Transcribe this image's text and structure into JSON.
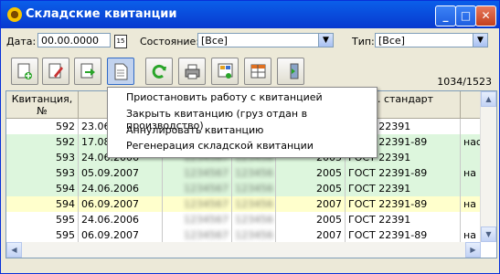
{
  "window": {
    "title": "Складские квитанции"
  },
  "filters": {
    "date_label": "Дата:",
    "date_value": "00.00.0000",
    "state_label": "Состояние:",
    "state_value": "[Все]",
    "type_label": "Тип:",
    "type_value": "[Все]"
  },
  "toolbar": {
    "counter": "1034/1523"
  },
  "context_menu": [
    "Приостановить работу с квитанцией",
    "Закрыть квитанцию (груз отдан в производство)",
    "Аннулировать квитанцию",
    "Регенерация складской квитанции"
  ],
  "table": {
    "headers": [
      "Квитанция, №",
      "Да",
      "",
      "",
      "",
      "с. стандарт",
      ""
    ],
    "rows": [
      {
        "n": "592",
        "date": "23.06.",
        "c3": "",
        "c4": "",
        "year": "",
        "std": "ГОСТ 22391",
        "extra": "",
        "bg": "#ffffff"
      },
      {
        "n": "592",
        "date": "17.08.",
        "c3": "",
        "c4": "",
        "year": "",
        "std": "ГОСТ 22391-89",
        "extra": "нас",
        "bg": "#ddf6dd"
      },
      {
        "n": "593",
        "date": "24.06.2006",
        "c3": "1234567",
        "c4": "123456",
        "year": "2005",
        "std": "ГОСТ 22391",
        "extra": "",
        "bg": "#ddf6dd"
      },
      {
        "n": "593",
        "date": "05.09.2007",
        "c3": "1234567",
        "c4": "123456",
        "year": "2005",
        "std": "ГОСТ 22391-89",
        "extra": "на г",
        "bg": "#ddf6dd"
      },
      {
        "n": "594",
        "date": "24.06.2006",
        "c3": "1234567",
        "c4": "123456",
        "year": "2005",
        "std": "ГОСТ 22391",
        "extra": "",
        "bg": "#ddf6dd"
      },
      {
        "n": "594",
        "date": "06.09.2007",
        "c3": "1234567",
        "c4": "123456",
        "year": "2007",
        "std": "ГОСТ 22391-89",
        "extra": "на г",
        "bg": "#ffffcc"
      },
      {
        "n": "595",
        "date": "24.06.2006",
        "c3": "1234567",
        "c4": "123456",
        "year": "2005",
        "std": "ГОСТ 22391",
        "extra": "",
        "bg": "#ffffff"
      },
      {
        "n": "595",
        "date": "06.09.2007",
        "c3": "1234567",
        "c4": "123456",
        "year": "2007",
        "std": "ГОСТ 22391-89",
        "extra": "на г",
        "bg": "#ffffff"
      }
    ]
  }
}
